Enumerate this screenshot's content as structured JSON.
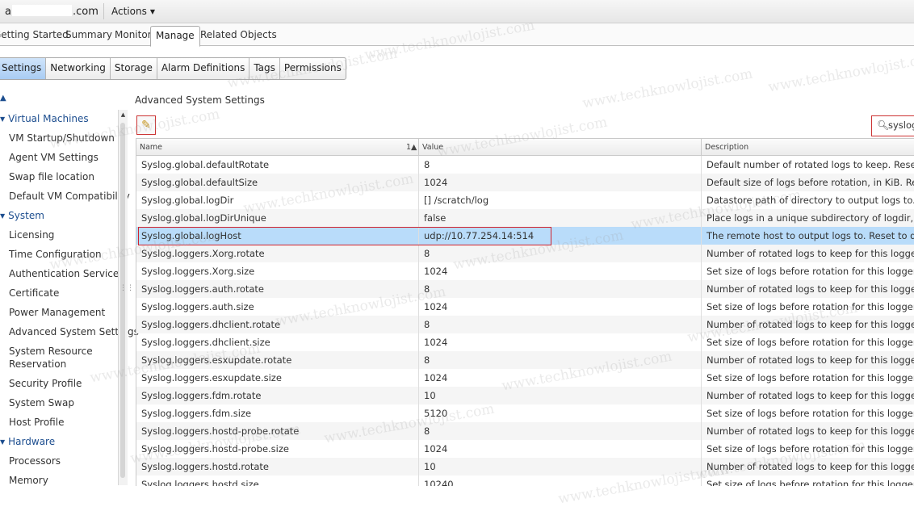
{
  "header": {
    "host_prefix": "a",
    "host_suffix": ".com",
    "actions_label": "Actions"
  },
  "main_tabs": [
    "Getting Started",
    "Summary",
    "Monitor",
    "Manage",
    "Related Objects"
  ],
  "sub_tabs": [
    "Settings",
    "Networking",
    "Storage",
    "Alarm Definitions",
    "Tags",
    "Permissions"
  ],
  "sidebar": {
    "virtual_machines": {
      "label": "Virtual Machines",
      "items": [
        "VM Startup/Shutdown",
        "Agent VM Settings",
        "Swap file location",
        "Default VM Compatibility"
      ]
    },
    "system": {
      "label": "System",
      "items": [
        "Licensing",
        "Time Configuration",
        "Authentication Services",
        "Certificate",
        "Power Management",
        "Advanced System Settings",
        "System Resource Reservation",
        "Security Profile",
        "System Swap",
        "Host Profile"
      ]
    },
    "hardware": {
      "label": "Hardware",
      "items": [
        "Processors",
        "Memory"
      ]
    }
  },
  "content": {
    "title": "Advanced System Settings",
    "search_value": "syslog",
    "columns": {
      "name": "Name",
      "sort": "1▲",
      "value": "Value",
      "description": "Description"
    },
    "rows": [
      {
        "name": "Syslog.global.defaultRotate",
        "value": "8",
        "description": "Default number of rotated logs to keep. Reset to defaul"
      },
      {
        "name": "Syslog.global.defaultSize",
        "value": "1024",
        "description": "Default size of logs before rotation, in KiB. Reset to de"
      },
      {
        "name": "Syslog.global.logDir",
        "value": "[] /scratch/log",
        "description": "Datastore path of directory to output logs to. Reset to d"
      },
      {
        "name": "Syslog.global.logDirUnique",
        "value": "false",
        "description": "Place logs in a unique subdirectory of logdir, based on"
      },
      {
        "name": "Syslog.global.logHost",
        "value": "udp://10.77.254.14:514",
        "description": "The remote host to output logs to. Reset to default on"
      },
      {
        "name": "Syslog.loggers.Xorg.rotate",
        "value": "8",
        "description": "Number of rotated logs to keep for this logger. Reset t"
      },
      {
        "name": "Syslog.loggers.Xorg.size",
        "value": "1024",
        "description": "Set size of logs before rotation for this logger, in KiB. R"
      },
      {
        "name": "Syslog.loggers.auth.rotate",
        "value": "8",
        "description": "Number of rotated logs to keep for this logger. Reset t"
      },
      {
        "name": "Syslog.loggers.auth.size",
        "value": "1024",
        "description": "Set size of logs before rotation for this logger, in KiB. R"
      },
      {
        "name": "Syslog.loggers.dhclient.rotate",
        "value": "8",
        "description": "Number of rotated logs to keep for this logger. Reset t"
      },
      {
        "name": "Syslog.loggers.dhclient.size",
        "value": "1024",
        "description": "Set size of logs before rotation for this logger, in KiB. R"
      },
      {
        "name": "Syslog.loggers.esxupdate.rotate",
        "value": "8",
        "description": "Number of rotated logs to keep for this logger. Reset t"
      },
      {
        "name": "Syslog.loggers.esxupdate.size",
        "value": "1024",
        "description": "Set size of logs before rotation for this logger, in KiB. R"
      },
      {
        "name": "Syslog.loggers.fdm.rotate",
        "value": "10",
        "description": "Number of rotated logs to keep for this logger. Reset t"
      },
      {
        "name": "Syslog.loggers.fdm.size",
        "value": "5120",
        "description": "Set size of logs before rotation for this logger, in KiB. R"
      },
      {
        "name": "Syslog.loggers.hostd-probe.rotate",
        "value": "8",
        "description": "Number of rotated logs to keep for this logger. Reset t"
      },
      {
        "name": "Syslog.loggers.hostd-probe.size",
        "value": "1024",
        "description": "Set size of logs before rotation for this logger, in KiB. R"
      },
      {
        "name": "Syslog.loggers.hostd.rotate",
        "value": "10",
        "description": "Number of rotated logs to keep for this logger. Reset t"
      },
      {
        "name": "Syslog.loggers.hostd.size",
        "value": "10240",
        "description": "Set size of logs before rotation for this logger, in KiB. R"
      }
    ],
    "selected_row": 4
  },
  "watermark": "www.techknowlojist.com",
  "colors": {
    "accent": "#1d4e8f",
    "selected_row": "#b9dcfa",
    "highlight_border": "#d0232e"
  }
}
